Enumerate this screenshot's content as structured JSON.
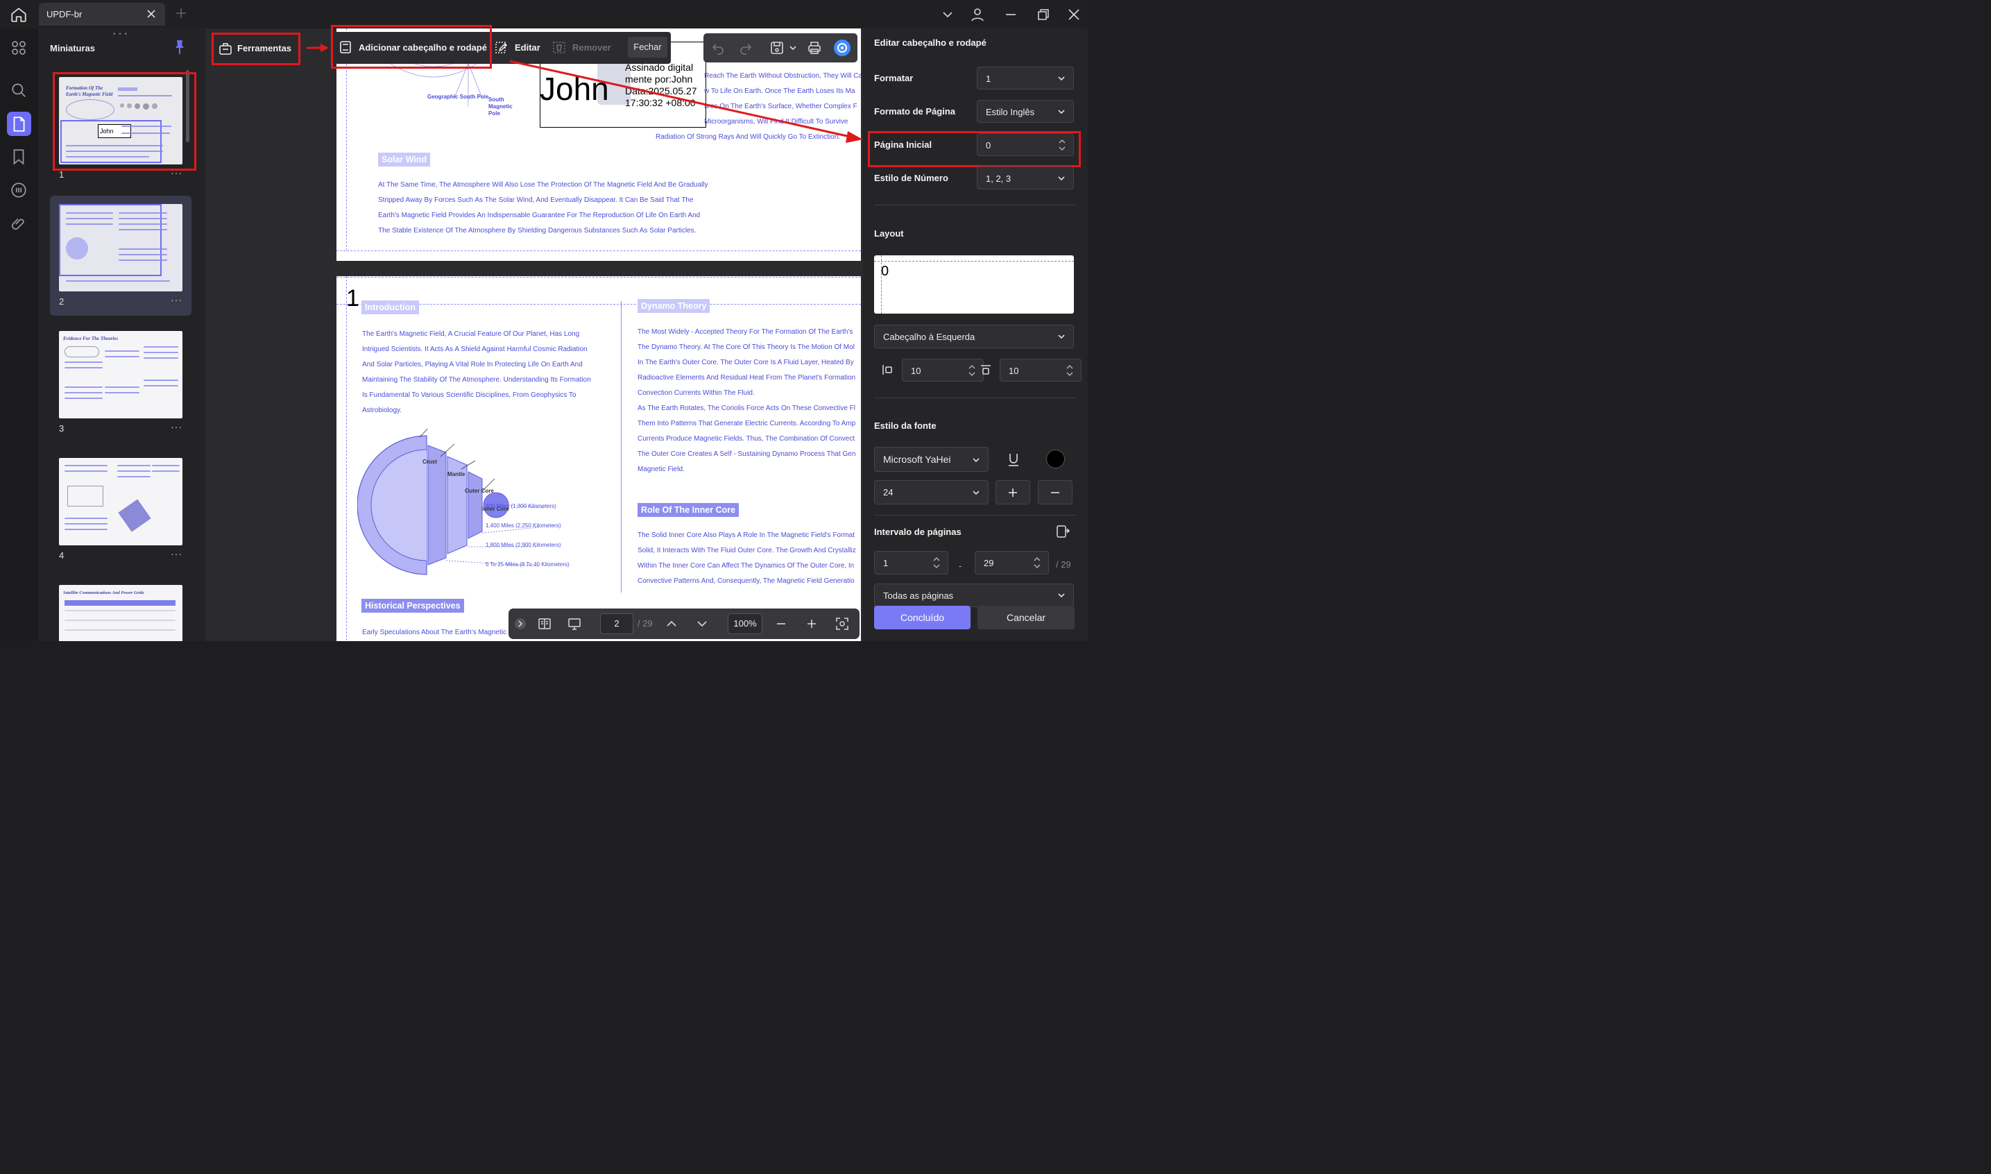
{
  "titlebar": {
    "tab_label": "UPDF-br"
  },
  "thumbnails": {
    "title": "Miniaturas",
    "pages": [
      {
        "num": "1",
        "more": "···",
        "title_a": "Formation Of The",
        "title_b": "Earth's Magnetic Field",
        "sig": "John"
      },
      {
        "num": "2",
        "more": "···"
      },
      {
        "num": "3",
        "more": "···",
        "title_a": "Evidence For The Theories"
      },
      {
        "num": "4",
        "more": "···"
      },
      {
        "num": "",
        "more": "",
        "title_a": "Satellite Communications And Power Grids"
      }
    ]
  },
  "toolbar": {
    "tools_label": "Ferramentas",
    "add_header_footer": "Adicionar cabeçalho e rodapé",
    "edit": "Editar",
    "remove": "Remover",
    "close": "Fechar"
  },
  "signature": {
    "name": "John",
    "info": "Assinado digital mente por:John Data:2025.05.27 17:30:32 +08:00"
  },
  "page_top": {
    "geo_south": "Geographic South Pole",
    "south_mag": "South Magnetic Pole",
    "right_lines": [
      "Reach The Earth Without Obstruction, They Will Ca",
      "w To Life On Earth. Once The Earth Loses Its Ma",
      "ures On The Earth's Surface, Whether Complex F",
      "Microorganisms, Will Find It Difficult To Survive",
      "Radiation Of Strong Rays And Will Quickly Go To Extinction."
    ],
    "solar_wind": "Solar Wind",
    "solar_lines": [
      "At The Same Time, The Atmosphere Will Also Lose The Protection Of The Magnetic Field And Be Gradually",
      "Stripped Away By Forces Such As The Solar Wind, And Eventually Disappear. It Can Be Said That The",
      "Earth's Magnetic Field Provides An Indispensable Guarantee For The Reproduction Of Life On Earth And",
      "The Stable Existence Of The Atmosphere By Shielding Dangerous Substances Such As Solar Particles."
    ]
  },
  "page_two": {
    "header_number": "1",
    "intro_title": "Introduction",
    "intro_lines": [
      "The Earth's Magnetic Field, A Crucial Feature Of Our Planet, Has Long",
      "Intrigued Scientists. It Acts As A Shield Against Harmful Cosmic Radiation",
      "And Solar Particles, Playing A Vital Role In Protecting Life On Earth And",
      "Maintaining The Stability Of The Atmosphere. Understanding Its Formation",
      "Is Fundamental To Various Scientific Disciplines, From Geophysics To",
      "Astrobiology."
    ],
    "diagram_labels": [
      "Crust",
      "Mantle",
      "Outer Core",
      "Inner Core"
    ],
    "distances": [
      "800 Miles (1,300 Kilometers)",
      "1,400 Miles (2,250 Kilometers)",
      "1,800 Miles (2,900 Kilometers)",
      "5 To 25 Miles (8 To 40 Kilometers)"
    ],
    "historical_title": "Historical Perspectives",
    "historical_line": "Early Speculations About The Earth's Magnetic",
    "dynamo_title": "Dynamo Theory",
    "dynamo_lines": [
      "The Most Widely - Accepted Theory For The Formation Of The Earth's",
      "The Dynamo Theory. At The Core Of This Theory Is The Motion Of Mol",
      "In The Earth's Outer Core. The Outer Core Is A Fluid Layer, Heated By",
      "Radioactive Elements And Residual Heat From The Planet's Formation",
      "Convection Currents Within The Fluid.",
      "As The Earth Rotates, The Coriolis Force Acts On These Convective Fl",
      "Them Into Patterns That Generate Electric Currents. According To Amp",
      "Currents Produce Magnetic Fields. Thus, The Combination Of Convect",
      "The Outer Core Creates A Self - Sustaining Dynamo Process That Gen",
      "Magnetic Field."
    ],
    "inner_title": "Role Of The Inner Core",
    "inner_lines": [
      "The Solid Inner Core Also Plays A Role In The Magnetic Field's Format",
      "Solid, It Interacts With The Fluid Outer Core. The Growth And Crystalliz",
      "Within The Inner Core Can Affect The Dynamics Of The Outer Core, In",
      "Convective Patterns And, Consequently, The Magnetic Field Generatio"
    ]
  },
  "bottom_nav": {
    "page": "2",
    "total": "/ 29",
    "zoom": "100%"
  },
  "panel": {
    "title": "Editar cabeçalho e rodapé",
    "format_label": "Formatar",
    "format_value": "1",
    "page_format_label": "Formato de Página",
    "page_format_value": "Estilo Inglês",
    "start_page_label": "Página Inicial",
    "start_page_value": "0",
    "number_style_label": "Estilo de Número",
    "number_style_value": "1, 2, 3",
    "layout_label": "Layout",
    "layout_preview": "0",
    "position_value": "Cabeçalho à Esquerda",
    "margin_left": "10",
    "margin_top": "10",
    "font_style_label": "Estilo da fonte",
    "font_value": "Microsoft YaHei",
    "font_size": "24",
    "range_label": "Intervalo de páginas",
    "range_from": "1",
    "range_sep": "-",
    "range_to": "29",
    "range_total": "/ 29",
    "range_subset": "Todas as páginas",
    "done": "Concluído",
    "cancel": "Cancelar"
  }
}
